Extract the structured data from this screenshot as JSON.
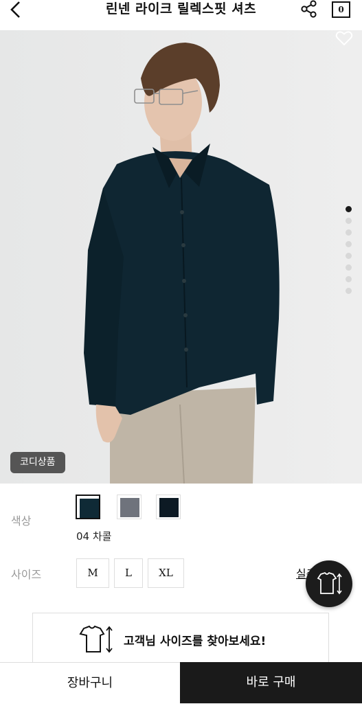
{
  "header": {
    "title": "린넨 라이크 릴렉스핏 셔츠",
    "cart_count": "0",
    "back_icon": "chevron-left-icon",
    "share_icon": "share-icon",
    "cart_icon": "shopping-bag-icon"
  },
  "hero": {
    "image_slide_count": 8,
    "active_slide": 1,
    "wishlist_icon": "heart-outline-icon",
    "badge": "코디상품"
  },
  "options": {
    "color_label": "색상",
    "colors": [
      {
        "hex": "#0f2a36",
        "selected": true
      },
      {
        "hex": "#6f737c",
        "selected": false
      },
      {
        "hex": "#0d1a24",
        "selected": false
      }
    ],
    "selected_color_name": "04 차콜",
    "size_label": "사이즈",
    "sizes": [
      "M",
      "L",
      "XL"
    ],
    "size_guide_link": "실측사이즈"
  },
  "size_finder": {
    "label": "고객님 사이즈를 찾아보세요!",
    "icon": "shirt-size-icon"
  },
  "bottom": {
    "cart_button": "장바구니",
    "buy_button": "바로 구매"
  },
  "colors": {
    "buy_button_bg": "#1a1a1a",
    "badge_bg": "#555555"
  }
}
